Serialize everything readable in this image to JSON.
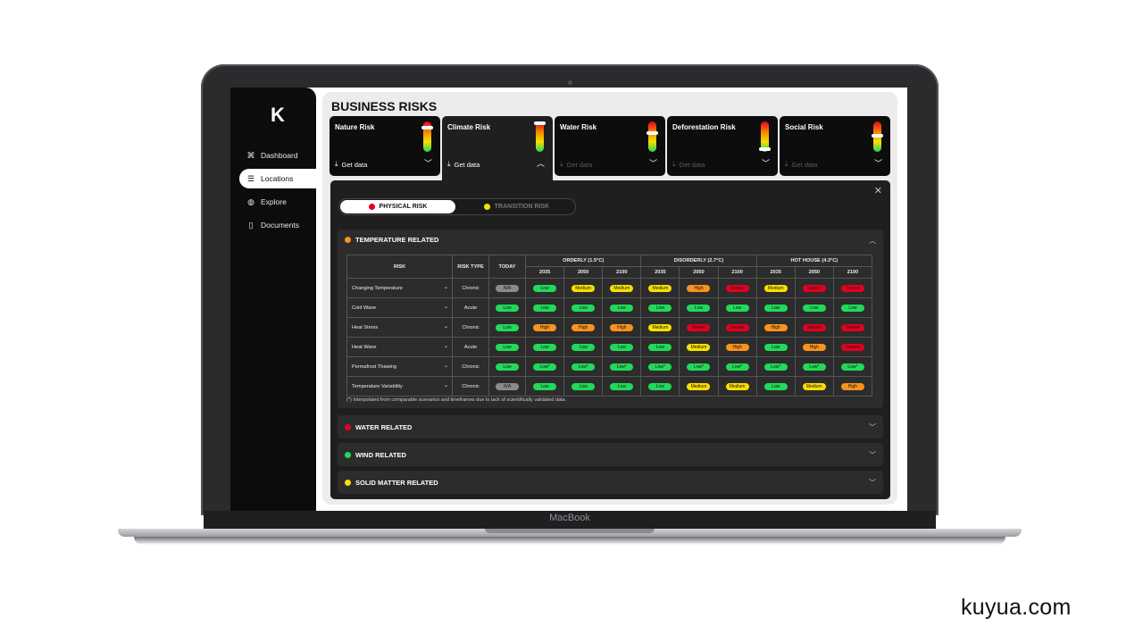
{
  "brand": "kuyua.com",
  "device_label": "MacBook",
  "sidebar": {
    "logo": "K",
    "items": [
      {
        "label": "Dashboard",
        "icon": "command-icon"
      },
      {
        "label": "Locations",
        "icon": "list-icon",
        "active": true
      },
      {
        "label": "Explore",
        "icon": "globe-icon"
      },
      {
        "label": "Documents",
        "icon": "document-icon"
      }
    ]
  },
  "page_title": "BUSINESS RISKS",
  "risk_cards": [
    {
      "name": "Nature Risk",
      "get_data": "Get data",
      "enabled": true,
      "level": 0.18
    },
    {
      "name": "Climate Risk",
      "get_data": "Get data",
      "enabled": true,
      "level": 0.0,
      "expanded": true
    },
    {
      "name": "Water Risk",
      "get_data": "Get data",
      "enabled": false,
      "level": 0.36
    },
    {
      "name": "Deforestation Risk",
      "get_data": "Get data",
      "enabled": false,
      "level": 0.95
    },
    {
      "name": "Social Risk",
      "get_data": "Get data",
      "enabled": false,
      "level": 0.45
    }
  ],
  "toggle": {
    "physical": "PHYSICAL RISK",
    "transition": "TRANSITION RISK"
  },
  "sections": {
    "temperature": {
      "title": "TEMPERATURE RELATED",
      "color": "#f7931e"
    },
    "water": {
      "title": "WATER RELATED",
      "color": "#e5001f"
    },
    "wind": {
      "title": "WIND RELATED",
      "color": "#22d95a"
    },
    "solid": {
      "title": "SOLID MATTER RELATED",
      "color": "#f7e000"
    }
  },
  "table": {
    "headers": {
      "risk": "RISK",
      "risk_type": "RISK TYPE",
      "today": "TODAY"
    },
    "scenarios": [
      "ORDERLY (1.5°C)",
      "DISORDERLY (2.7°C)",
      "HOT HOUSE (4.3°C)"
    ],
    "years": [
      "2035",
      "2050",
      "2100"
    ],
    "rows": [
      {
        "name": "Changing Temperature",
        "type": "Chronic",
        "today": "N/A",
        "values": [
          "Low",
          "Medium",
          "Medium",
          "Medium",
          "High",
          "Severe",
          "Medium",
          "Severe",
          "Severe"
        ]
      },
      {
        "name": "Cold Wave",
        "type": "Acute",
        "today": "Low",
        "values": [
          "Low",
          "Low",
          "Low",
          "Low",
          "Low",
          "Low",
          "Low",
          "Low",
          "Low"
        ]
      },
      {
        "name": "Heat Stress",
        "type": "Chronic",
        "today": "Low",
        "values": [
          "High",
          "High",
          "High",
          "Medium",
          "Severe",
          "Severe",
          "High",
          "Severe",
          "Severe"
        ]
      },
      {
        "name": "Heat Wave",
        "type": "Acute",
        "today": "Low",
        "values": [
          "Low",
          "Low",
          "Low",
          "Low",
          "Medium",
          "High",
          "Low",
          "High",
          "Severe"
        ]
      },
      {
        "name": "Permafrost Thawing",
        "type": "Chronic",
        "today": "Low",
        "values": [
          "Low*",
          "Low*",
          "Low*",
          "Low*",
          "Low*",
          "Low*",
          "Low*",
          "Low*",
          "Low*"
        ]
      },
      {
        "name": "Temperature Variability",
        "type": "Chronic",
        "today": "N/A",
        "values": [
          "Low",
          "Low",
          "Low",
          "Low",
          "Medium",
          "Medium",
          "Low",
          "Medium",
          "High"
        ]
      }
    ],
    "footnote": "(*) Interpolated from comparable scenarios and timeframes due to lack of scientifically validated data."
  },
  "level_colors": {
    "Low": "#22d95a",
    "Low*": "#22d95a",
    "Medium": "#f7e000",
    "High": "#f7931e",
    "Severe": "#e5001f",
    "N/A": "#8a8a8a"
  }
}
